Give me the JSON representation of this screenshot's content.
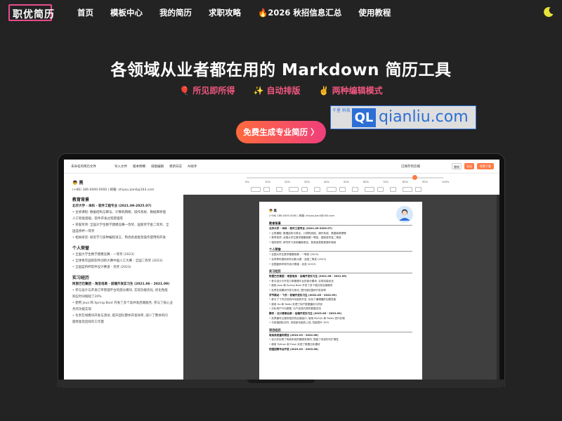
{
  "nav": {
    "logo_text": "职优简历",
    "links": [
      "首页",
      "模板中心",
      "我的简历",
      "求职攻略",
      "🔥2026 秋招信息汇总",
      "使用教程"
    ]
  },
  "hero": {
    "title": "各领域从业者都在用的 Markdown 简历工具",
    "features": [
      {
        "emoji": "🎈",
        "label": "所见即所得"
      },
      {
        "emoji": "✨",
        "label": "自动排版"
      },
      {
        "emoji": "✌️",
        "label": "两种编辑模式"
      }
    ],
    "cta_label": "免费生成专业简历 〉"
  },
  "watermark": {
    "left": "千里 科技",
    "badge": "QL",
    "text": "qianliu.com"
  },
  "app": {
    "title": "未命名的简历文件",
    "menu": [
      "导入文件",
      "版本明细",
      "排版编辑",
      "更新日志",
      "AI助手"
    ],
    "status": "已保存到云端",
    "buttons": [
      "撤销",
      "导出",
      "免费下载"
    ],
    "toolbar_percent": [
      "0%",
      "10%",
      "20%",
      "30%",
      "40%",
      "50%",
      "60%",
      "70%",
      "80%",
      "90%",
      "100%"
    ]
  },
  "editor": {
    "name": "👦 黑",
    "contact": "(+86) 186-0000-0000 | 邮箱: zhiyou.jianli@163.com",
    "sections": [
      {
        "heading": "教育背景",
        "lines": [
          "北华大学 - 本科 - 软件工程专业 (2021.09-2025.07)",
          "• 主修课程: 数据结构与算法、计算机网络、操作系统、数据库原理",
          "  人工智能基础、软件开发过程管理等",
          "• 荣誉奖项: 全国大学生数学建模竞赛一等奖、国家奖学金二等奖、全",
          "  国蓝桥杯一等奖",
          "• 相关研究: 研究学习多种编程语言、熟悉各类框架操作使用和开发"
        ]
      },
      {
        "heading": "个人荣誉",
        "lines": [
          "• 全国大学生数学建模竞赛 - 一等奖 (2023)",
          "• 全球青年国际软件创新大赛中国人工大赛 - 全国二等奖 (2023)",
          "• 全国蓝桥杯软件设计赛道 - 优奖 (2023)"
        ]
      },
      {
        "heading": "实习经历",
        "lines": [
          "阿里巴巴集团 - 淘宝电商 - 前端开发实习生 (2021.06 - 2021.09)",
          "• 参与设计与开发订单管理平台的部分模块, 实现功能优化, 优化性能",
          "  响应时间缩短了20%",
          "• 使用 Java 和 Spring Boot 开发了多个高并发后端服务, 参与了核心业",
          "  务的功能实现",
          "• 负责在线模块开发与测试, 提升团队整体开发效率, 减少了整体的问",
          "  题修复及后续的工作量"
        ]
      }
    ]
  },
  "resume": {
    "name": "👦 黑",
    "contact": "(+86) 186-0000-0000 | 邮箱: zhiyou.jianli@163.com",
    "sections": [
      {
        "heading": "教育背景",
        "lines": [
          "北华大学 - 本科 - 软件工程专业 (2021.09-2025.07)",
          "• 主修课程: 数据结构与算法、计算机网络、操作系统、数据库原理等",
          "• 荣誉奖项: 全国大学生数学建模竞赛一等奖、国家奖学金二等奖",
          "• 相关研究: 研究学习多种编程语言、熟悉各类框架操作使用"
        ]
      },
      {
        "heading": "个人荣誉",
        "lines": [
          "• 全国大学生数学建模竞赛 - 一等奖 (2023)",
          "• 全球青年国际软件创新大赛 - 全国二等奖 (2023)",
          "• 全国蓝桥杯软件设计赛道 - 优奖 (2023)"
        ]
      },
      {
        "heading": "实习经历",
        "lines": [
          "阿里巴巴集团 - 淘宝电商 - 后端开发实习生 (2021.06 - 2021.09)",
          "• 参与设计与开发订单管理平台的部分模块, 实现功能优化",
          "• 使用 Java 和 Spring Boot 开发了多个高并发后端服务",
          "• 负责在线模块开发与测试, 提升团队整体开发效率",
          "字节跳动 - 飞书 - 前端开发实习生 (2022.06 - 2022.09)",
          "• 参与了飞书文档协作功能的开发, 优化了编辑器的加载性能",
          "• 使用 Go 和 Redis 处理了用户数据缓存与同步",
          "• 分析用户行为数据, 为产品迭代提供数据支持",
          "腾讯 - 云计算事业部 - 后端开发实习生 (2023.06 - 2023.09)",
          "• 负责编写云服务相关的后端接口, 使用 MySQL 和 Redis 进行存储",
          "• 与前端团队协作, 完成新功能的上线, 性能提升 30%"
        ]
      },
      {
        "heading": "项目经历",
        "lines": [
          "电商系统重构项目 (2022.03 - 2022.06)",
          "• 设计并实现了电商系统的微服务架构, 提高了系统的可扩展性",
          "• 使用 Python 和 Flask 实现了数据分析模块",
          "校园招聘平台开发 (2023.03 - 2023.06)"
        ]
      }
    ]
  }
}
